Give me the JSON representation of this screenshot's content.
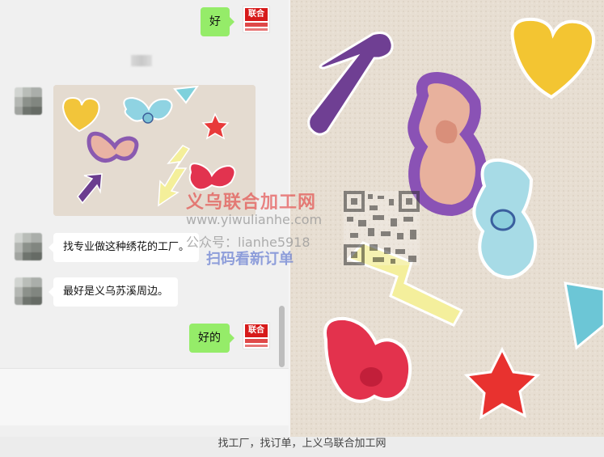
{
  "chat": {
    "messages": [
      {
        "from": "me",
        "text": "好"
      },
      {
        "from": "other",
        "type": "image"
      },
      {
        "from": "other",
        "text": "找专业做这种绣花的工厂。"
      },
      {
        "from": "other",
        "text": "最好是义乌苏溪周边。"
      },
      {
        "from": "me",
        "text": "好的"
      }
    ],
    "my_avatar_logo": "联合",
    "colors": {
      "my_bubble": "#95ec69",
      "other_bubble": "#ffffff",
      "logo": "#d71a1a"
    }
  },
  "watermark": {
    "title": "义乌联合加工网",
    "url": "www.yiwulianhe.com",
    "account": "公众号：lianhe5918",
    "scan": "扫码看新订单"
  },
  "footer": {
    "text": "找工厂，找订单，上义乌联合加工网"
  }
}
